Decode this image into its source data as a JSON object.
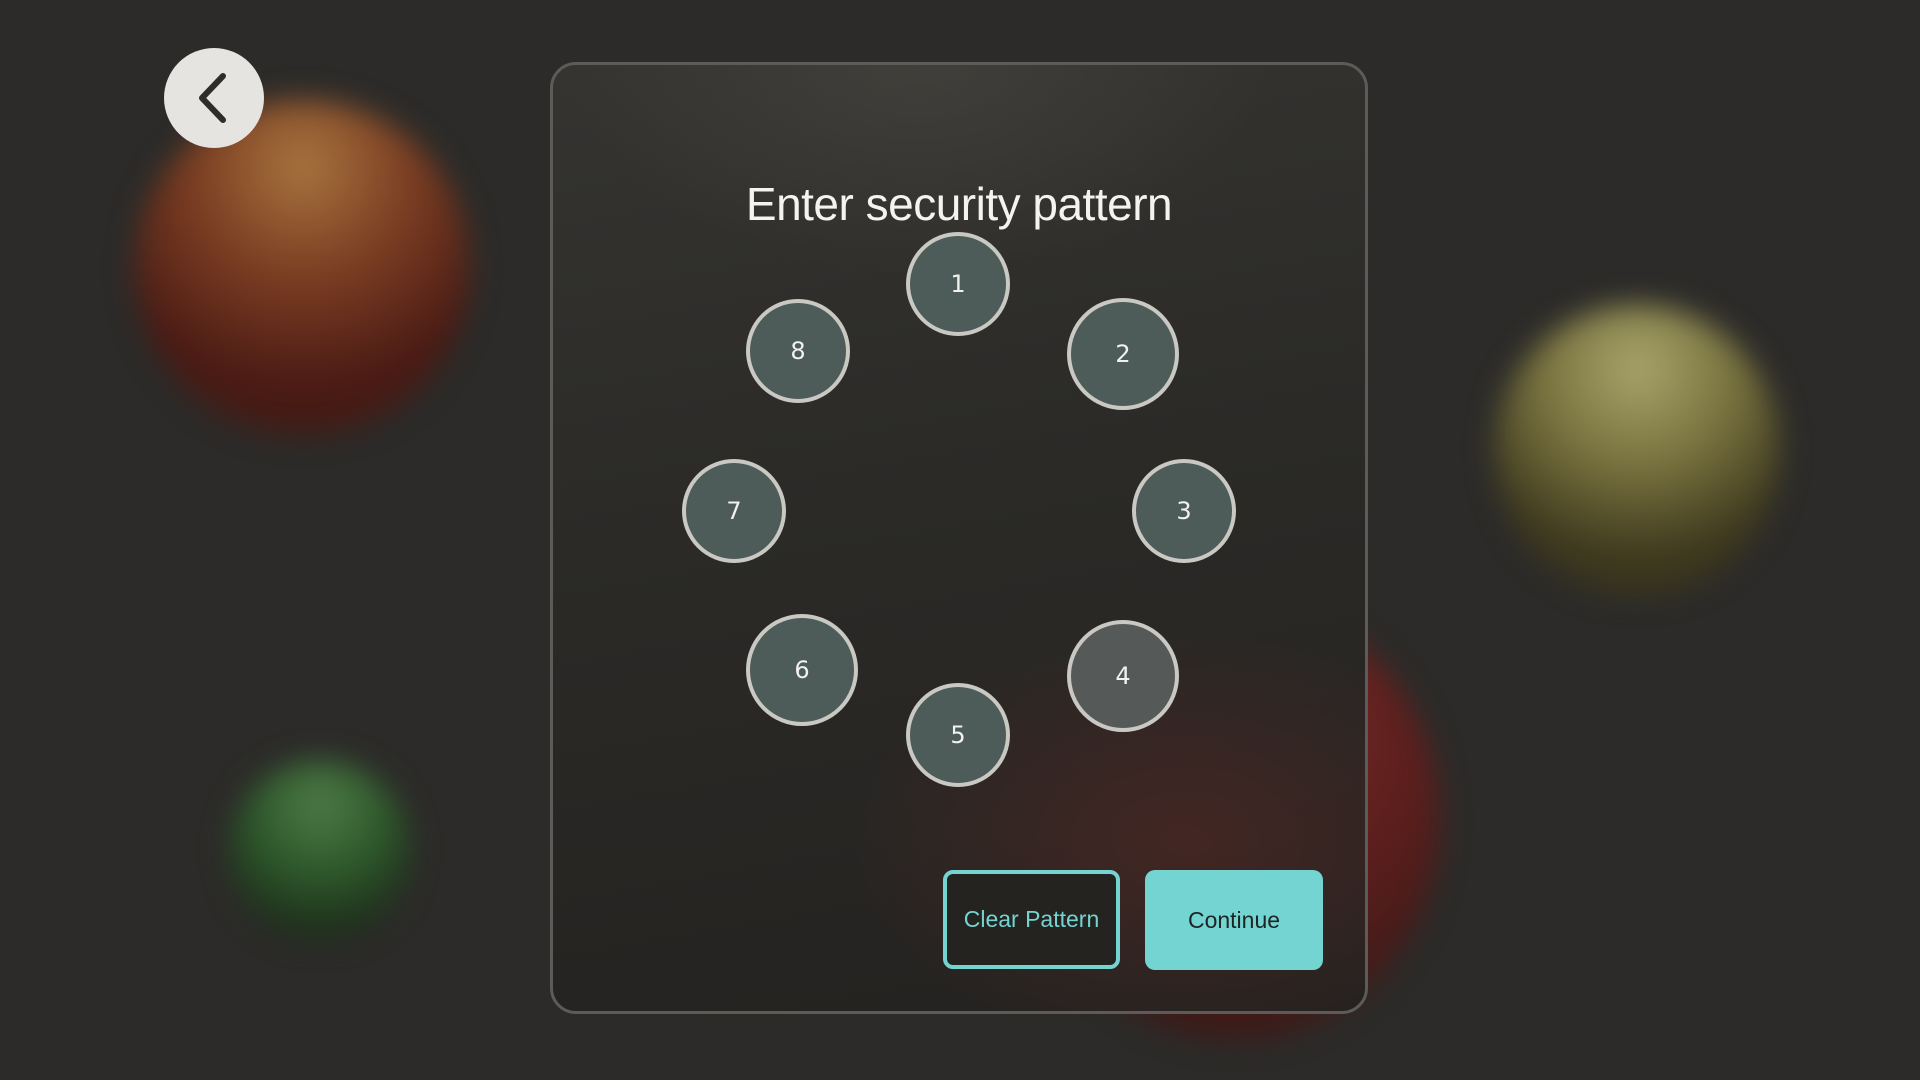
{
  "page": {
    "title": "Enter security pattern"
  },
  "navigation": {
    "back_icon": "chevron-left-icon"
  },
  "pattern": {
    "nodes": [
      {
        "id": "1",
        "label": "1"
      },
      {
        "id": "2",
        "label": "2"
      },
      {
        "id": "3",
        "label": "3"
      },
      {
        "id": "4",
        "label": "4"
      },
      {
        "id": "5",
        "label": "5"
      },
      {
        "id": "6",
        "label": "6"
      },
      {
        "id": "7",
        "label": "7"
      },
      {
        "id": "8",
        "label": "8"
      }
    ]
  },
  "actions": {
    "clear_label": "Clear Pattern",
    "continue_label": "Continue"
  },
  "colors": {
    "accent": "#74d4d2",
    "node_fill": "#4d5b59",
    "node_ring": "#c9c8c3",
    "background": "#2c2b29"
  }
}
